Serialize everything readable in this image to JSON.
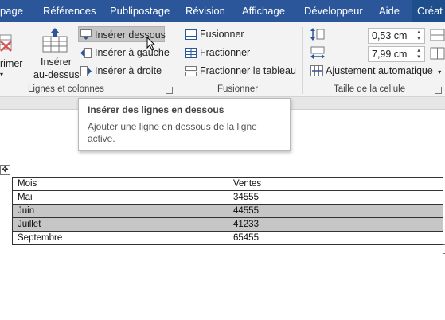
{
  "tabs": [
    {
      "label": "page"
    },
    {
      "label": "Références"
    },
    {
      "label": "Publipostage"
    },
    {
      "label": "Révision"
    },
    {
      "label": "Affichage"
    },
    {
      "label": "Développeur"
    },
    {
      "label": "Aide"
    },
    {
      "label": "Créat"
    }
  ],
  "ribbon": {
    "rows_cols": {
      "delete_label": "rimer",
      "insert_above_line1": "Insérer",
      "insert_above_line2": "au-dessus",
      "insert_below": "Insérer dessous",
      "insert_left": "Insérer à gauche",
      "insert_right": "Insérer à droite",
      "group_label": "Lignes et colonnes"
    },
    "merge": {
      "merge_cells": "Fusionner",
      "split_cells": "Fractionner",
      "split_table": "Fractionner le tableau",
      "group_label": "Fusionner"
    },
    "cell_size": {
      "height_value": "0,53 cm",
      "width_value": "7,99 cm",
      "autofit": "Ajustement automatique",
      "group_label": "Taille de la cellule"
    }
  },
  "tooltip": {
    "title": "Insérer des lignes en dessous",
    "body": "Ajouter une ligne en dessous de la ligne active."
  },
  "table": {
    "header": [
      "Mois",
      "Ventes"
    ],
    "rows": [
      {
        "month": "Mai",
        "sales": "34555",
        "selected": false
      },
      {
        "month": "Juin",
        "sales": "44555",
        "selected": true
      },
      {
        "month": "Juillet",
        "sales": "41233",
        "selected": true
      },
      {
        "month": "Septembre",
        "sales": "65455",
        "selected": false
      }
    ]
  },
  "colors": {
    "tab_bar": "#2b579a",
    "ribbon_bg": "#f3f3f3",
    "selected_row": "#c6c6c6",
    "icon_blue": "#2b579a",
    "delete_red": "#d9534f"
  }
}
